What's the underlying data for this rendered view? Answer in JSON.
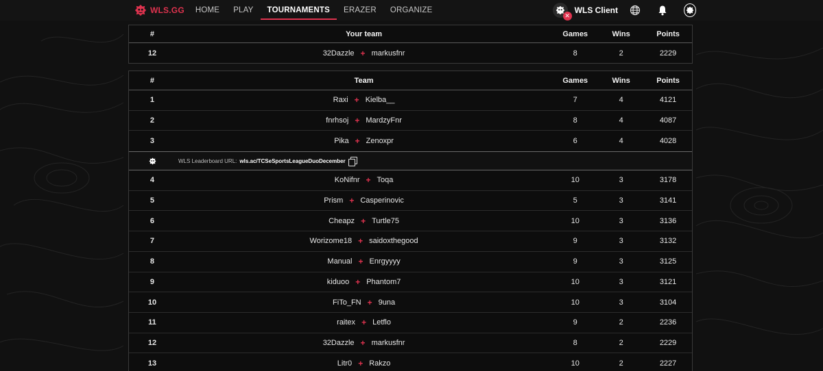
{
  "nav": {
    "brand": "WLS.GG",
    "items": [
      {
        "label": "HOME",
        "active": false
      },
      {
        "label": "PLAY",
        "active": false
      },
      {
        "label": "TOURNAMENTS",
        "active": true
      },
      {
        "label": "ERAZER",
        "active": false
      },
      {
        "label": "ORGANIZE",
        "active": false
      }
    ],
    "client_label": "WLS Client",
    "icons": [
      "globe-icon",
      "bell-icon",
      "profile-icon"
    ]
  },
  "colors": {
    "accent": "#e0334f",
    "background": "#111111",
    "table_bg": "#0d0d0d"
  },
  "your_team": {
    "headers": {
      "rank": "#",
      "team": "Your team",
      "games": "Games",
      "wins": "Wins",
      "points": "Points"
    },
    "row": {
      "rank": "12",
      "p1": "32Dazzle",
      "p2": "markusfnr",
      "games": "8",
      "wins": "2",
      "points": "2229"
    }
  },
  "leaderboard": {
    "headers": {
      "rank": "#",
      "team": "Team",
      "games": "Games",
      "wins": "Wins",
      "points": "Points"
    },
    "top_rows": [
      {
        "rank": "1",
        "p1": "Raxi",
        "p2": "Kielba__",
        "games": "7",
        "wins": "4",
        "points": "4121"
      },
      {
        "rank": "2",
        "p1": "fnrhsoj",
        "p2": "MardzyFnr",
        "games": "8",
        "wins": "4",
        "points": "4087"
      },
      {
        "rank": "3",
        "p1": "Pika",
        "p2": "Zenoxpr",
        "games": "6",
        "wins": "4",
        "points": "4028"
      }
    ],
    "url_label": "WLS Leaderboard URL:",
    "url": "wls.ac/TCSeSportsLeagueDuoDecember",
    "rows": [
      {
        "rank": "4",
        "p1": "KoNifnr",
        "p2": "Toqa",
        "games": "10",
        "wins": "3",
        "points": "3178"
      },
      {
        "rank": "5",
        "p1": "Prism",
        "p2": "Casperinovic",
        "games": "5",
        "wins": "3",
        "points": "3141"
      },
      {
        "rank": "6",
        "p1": "Cheapz",
        "p2": "Turtle75",
        "games": "10",
        "wins": "3",
        "points": "3136"
      },
      {
        "rank": "7",
        "p1": "Worizome18",
        "p2": "saidoxthegood",
        "games": "9",
        "wins": "3",
        "points": "3132"
      },
      {
        "rank": "8",
        "p1": "Manual",
        "p2": "Enrgyyyy",
        "games": "9",
        "wins": "3",
        "points": "3125"
      },
      {
        "rank": "9",
        "p1": "kiduoo",
        "p2": "Phantom7",
        "games": "10",
        "wins": "3",
        "points": "3121"
      },
      {
        "rank": "10",
        "p1": "FiTo_FN",
        "p2": "9una",
        "games": "10",
        "wins": "3",
        "points": "3104"
      },
      {
        "rank": "11",
        "p1": "raitex",
        "p2": "Letflo",
        "games": "9",
        "wins": "2",
        "points": "2236"
      },
      {
        "rank": "12",
        "p1": "32Dazzle",
        "p2": "markusfnr",
        "games": "8",
        "wins": "2",
        "points": "2229"
      },
      {
        "rank": "13",
        "p1": "Litr0",
        "p2": "Rakzo",
        "games": "10",
        "wins": "2",
        "points": "2227"
      }
    ]
  }
}
